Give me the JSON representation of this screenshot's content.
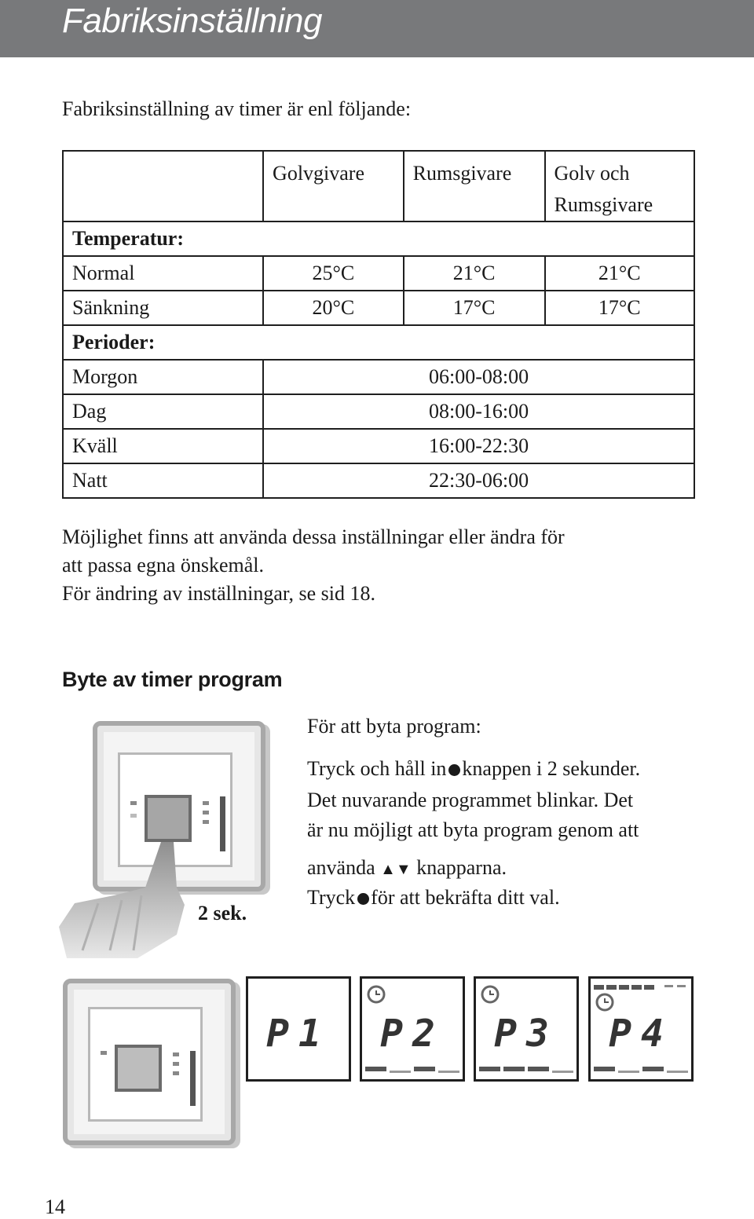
{
  "header": {
    "title": "Fabriksinställning"
  },
  "intro": "Fabriksinställning av timer är enl följande:",
  "table": {
    "columns": [
      "",
      "Golvgivare",
      "Rumsgivare",
      "Golv och Rumsgivare"
    ],
    "column_lines": {
      "c3_line1": "Golv och",
      "c3_line2": "Rumsgivare"
    },
    "temperature_section": "Temperatur:",
    "temperature_rows": [
      {
        "label": "Normal",
        "golvgivare": "25°C",
        "rumsgivare": "21°C",
        "golv_och_rumsgivare": "21°C"
      },
      {
        "label": "Sänkning",
        "golvgivare": "20°C",
        "rumsgivare": "17°C",
        "golv_och_rumsgivare": "17°C"
      }
    ],
    "periods_section": "Perioder:",
    "period_rows": [
      {
        "label": "Morgon",
        "value": "06:00-08:00"
      },
      {
        "label": "Dag",
        "value": "08:00-16:00"
      },
      {
        "label": "Kväll",
        "value": "16:00-22:30"
      },
      {
        "label": "Natt",
        "value": "22:30-06:00"
      }
    ]
  },
  "note": {
    "line1": "Möjlighet finns att använda dessa inställningar eller ändra för",
    "line2": "att passa egna önskemål.",
    "line3": "För ändring av inställningar, se sid 18."
  },
  "timer_section": {
    "heading": "Byte av timer program",
    "intro": "För att byta program:",
    "step1_a": "Tryck och håll in",
    "step1_b": "knappen i 2 sekunder.",
    "step2": "Det nuvarande programmet blinkar. Det",
    "step3": "är nu möjligt att byta program genom att",
    "step4_a": "använda",
    "step4_arrows": "▲▼",
    "step4_b": "knapparna.",
    "step5_a": "Tryck",
    "step5_b": "för att bekräfta ditt val.",
    "hold_label": "2 sek."
  },
  "program_displays": [
    {
      "label": "P1",
      "clock_icon": false,
      "top_bar": false,
      "bottom_bars": false
    },
    {
      "label": "P2",
      "clock_icon": true,
      "top_bar": false,
      "bottom_bars": true
    },
    {
      "label": "P3",
      "clock_icon": true,
      "top_bar": false,
      "bottom_bars": true
    },
    {
      "label": "P4",
      "clock_icon": true,
      "top_bar": true,
      "bottom_bars": true
    }
  ],
  "page_number": "14"
}
